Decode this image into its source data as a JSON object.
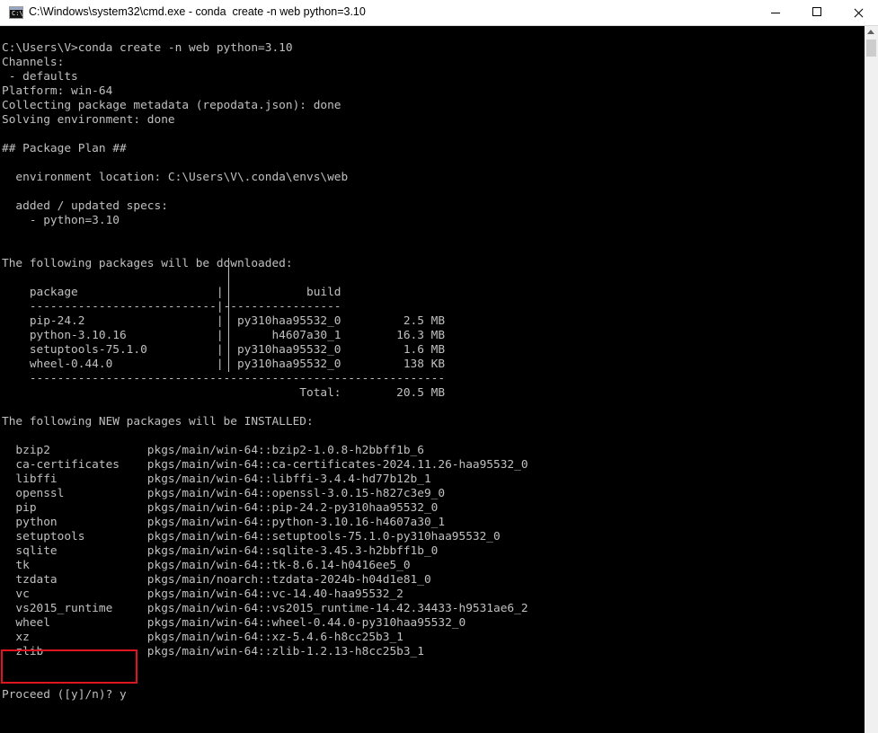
{
  "window": {
    "title": "C:\\Windows\\system32\\cmd.exe - conda  create -n web python=3.10"
  },
  "icons": {
    "app": "cmd-icon",
    "minimize": "minimize-icon",
    "maximize": "maximize-icon",
    "close": "close-icon"
  },
  "console": {
    "lines": [
      "C:\\Users\\V>conda create -n web python=3.10",
      "Channels:",
      " - defaults",
      "Platform: win-64",
      "Collecting package metadata (repodata.json): done",
      "Solving environment: done",
      "",
      "## Package Plan ##",
      "",
      "  environment location: C:\\Users\\V\\.conda\\envs\\web",
      "",
      "  added / updated specs:",
      "    - python=3.10",
      "",
      "",
      "The following packages will be downloaded:",
      "",
      "    package                    |            build",
      "    ---------------------------|-----------------",
      "    pip-24.2                   |  py310haa95532_0         2.5 MB",
      "    python-3.10.16             |       h4607a30_1        16.3 MB",
      "    setuptools-75.1.0          |  py310haa95532_0         1.6 MB",
      "    wheel-0.44.0               |  py310haa95532_0         138 KB",
      "    ------------------------------------------------------------",
      "                                           Total:        20.5 MB",
      "",
      "The following NEW packages will be INSTALLED:",
      "",
      "  bzip2              pkgs/main/win-64::bzip2-1.0.8-h2bbff1b_6",
      "  ca-certificates    pkgs/main/win-64::ca-certificates-2024.11.26-haa95532_0",
      "  libffi             pkgs/main/win-64::libffi-3.4.4-hd77b12b_1",
      "  openssl            pkgs/main/win-64::openssl-3.0.15-h827c3e9_0",
      "  pip                pkgs/main/win-64::pip-24.2-py310haa95532_0",
      "  python             pkgs/main/win-64::python-3.10.16-h4607a30_1",
      "  setuptools         pkgs/main/win-64::setuptools-75.1.0-py310haa95532_0",
      "  sqlite             pkgs/main/win-64::sqlite-3.45.3-h2bbff1b_0",
      "  tk                 pkgs/main/win-64::tk-8.6.14-h0416ee5_0",
      "  tzdata             pkgs/main/noarch::tzdata-2024b-h04d1e81_0",
      "  vc                 pkgs/main/win-64::vc-14.40-haa95532_2",
      "  vs2015_runtime     pkgs/main/win-64::vs2015_runtime-14.42.34433-h9531ae6_2",
      "  wheel              pkgs/main/win-64::wheel-0.44.0-py310haa95532_0",
      "  xz                 pkgs/main/win-64::xz-5.4.6-h8cc25b3_1",
      "  zlib               pkgs/main/win-64::zlib-1.2.13-h8cc25b3_1",
      "",
      "",
      "Proceed ([y]/n)? y"
    ]
  },
  "colors": {
    "console_bg": "#000000",
    "console_text": "#c0c0c0",
    "highlight_border": "#e0141e"
  }
}
